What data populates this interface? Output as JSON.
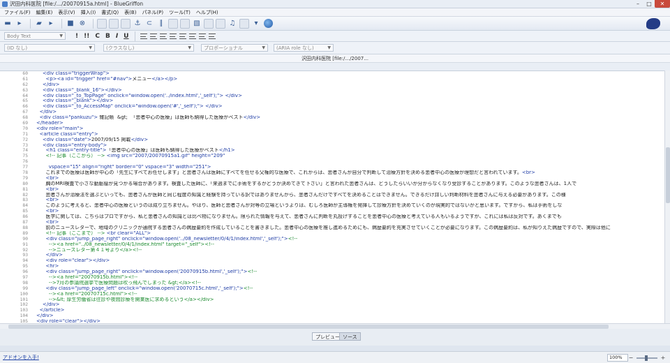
{
  "window": {
    "title": "沢田内科医院 [file:/.../20070915a.html] - BlueGriffon",
    "controls": [
      "–",
      "□",
      "✕"
    ]
  },
  "menu": [
    "ファイル(F)",
    "編集(E)",
    "表示(V)",
    "挿入(I)",
    "書式(Q)",
    "表(B)",
    "パネル(P)",
    "ツール(T)",
    "ヘルプ(H)"
  ],
  "format_toolbar": {
    "paragraph_style": "Body Text",
    "buttons": [
      "!",
      "!!",
      "C",
      "B",
      "I",
      "U"
    ]
  },
  "style_toolbar": {
    "id_select": "(ID なし)",
    "class_select": "(クラスなし)",
    "role_select": "プロポーショナル",
    "aria_select": "(ARIA role なし)"
  },
  "doc_tab_title": "沢田内科医院 [file:/.../2007...",
  "source_lines": [
    {
      "n": "60",
      "segs": [
        [
          "tag",
          "    <div class=\"triggerWrap\">"
        ]
      ]
    },
    {
      "n": "61",
      "segs": [
        [
          "tag",
          "      <p><a id=\"trigger\" href=\"#nav\">"
        ],
        [
          "txt",
          "メニュー"
        ],
        [
          "tag",
          "</a></p>"
        ]
      ]
    },
    {
      "n": "62",
      "segs": [
        [
          "tag",
          "    </div>"
        ]
      ]
    },
    {
      "n": "63",
      "segs": [
        [
          "tag",
          "    <div class=\"_blank_16\"></div>"
        ]
      ]
    },
    {
      "n": "64",
      "segs": [
        [
          "tag",
          "    <div class=\"_to_TopPage\" onclick=\"window.open('../index.html','_self');\"> </div>"
        ]
      ]
    },
    {
      "n": "65",
      "segs": [
        [
          "tag",
          "    <div class=\"_blank\"></div>"
        ]
      ]
    },
    {
      "n": "66",
      "segs": [
        [
          "tag",
          "    <div class=\"_to_AccessMap\" onclick=\"window.open('#','_self');\"> </div>"
        ]
      ]
    },
    {
      "n": "67",
      "segs": [
        [
          "tag",
          "  </div>"
        ]
      ]
    },
    {
      "n": "68",
      "segs": [
        [
          "tag",
          "  <div class=\"pankuzu\">"
        ],
        [
          "txt",
          " 雑記帳  &gt;  「患者中心の医療」は医師も納得した医療がベスト"
        ],
        [
          "tag",
          "</div>"
        ]
      ]
    },
    {
      "n": "69",
      "segs": [
        [
          "tag",
          "</header>"
        ]
      ]
    },
    {
      "n": "70",
      "segs": [
        [
          "tag",
          "<div role=\"main\">"
        ]
      ]
    },
    {
      "n": "71",
      "segs": [
        [
          "tag",
          "  <article class=\"entry\">"
        ]
      ]
    },
    {
      "n": "72",
      "segs": [
        [
          "tag",
          "    <div class=\"date\">"
        ],
        [
          "txt",
          "2007/09/15 掲載"
        ],
        [
          "tag",
          "</div>"
        ]
      ]
    },
    {
      "n": "73",
      "segs": [
        [
          "tag",
          "    <div class=\"entry-body\">"
        ]
      ]
    },
    {
      "n": "74",
      "segs": [
        [
          "tag",
          "      <h1 class=\"entry-title\">"
        ],
        [
          "txt",
          "「患者中心の医療」は医師も納得した医療がベスト"
        ],
        [
          "tag",
          "</h1>"
        ]
      ]
    },
    {
      "n": "75",
      "segs": [
        [
          "comment",
          "      <!-- 記事（ここから） -->"
        ],
        [
          "tag",
          " <img src=\"2007/20070915a1.gif\" height=\"209\""
        ]
      ]
    },
    {
      "n": "76",
      "segs": [
        [
          "txt",
          ""
        ]
      ]
    },
    {
      "n": "77",
      "segs": [
        [
          "tag",
          "        vspace=\"15\" align=\"right\" border=\"0\" vspace=\"3\" width=\"251\">"
        ]
      ]
    },
    {
      "n": "78",
      "segs": [
        [
          "txt",
          "      これまでの医療は医師が中心の「先生にすべてお任せします」と患者さんは医師にすべてを任せる父権的な医療で、これからは、患者さんが自分で判断して治療方針を決める患者中心の医療が理想だと言われています。"
        ],
        [
          "tag",
          "<br>"
        ]
      ]
    },
    {
      "n": "79",
      "segs": [
        [
          "tag",
          "      <br>"
        ]
      ]
    },
    {
      "n": "80",
      "segs": [
        [
          "txt",
          "      胸のMRI検査で小さな動脈瘤が見つかる場合があります。検査した医師に、「来週までに手術をするかどうか決めてきて下さい」と言われた患者さんは、どうしたらいいか分からなくなり受診することがあります。このような患者さんは、1人で"
        ]
      ]
    },
    {
      "n": "81",
      "segs": [
        [
          "tag",
          "      <br>"
        ]
      ]
    },
    {
      "n": "82",
      "segs": [
        [
          "txt",
          "      患者さんが治療法を選ぶといっても、患者さんが医師と同じ程度の知識と経験を持っている訳ではありませんから、患者さんだけですべてを決めることはできません。できるだけ詳しい判断材料を患者さんに与える必要があります。この様"
        ]
      ]
    },
    {
      "n": "83",
      "segs": [
        [
          "tag",
          "      <br>"
        ]
      ]
    },
    {
      "n": "84",
      "segs": [
        [
          "txt",
          "      このように考えると、患者中心の医療というのは成り立ちません。やはり、医師と患者さんが対等の立場というよりは、むしろ医師が主導権を発揮して診療方針を決めていくのが現実的ではないかと思います。ですから、私は手術をしな"
        ]
      ]
    },
    {
      "n": "85",
      "segs": [
        [
          "tag",
          "      <br>"
        ]
      ]
    },
    {
      "n": "86",
      "segs": [
        [
          "txt",
          "      医学に関しては、こちらはプロですから、私と患者さんの知識とは比べ物になりません。限られた情報を与えて、患者さんに判断を丸投げすることを患者中心の医療と考えている人もいるようですが、これには私は反対です。あくまでも"
        ]
      ]
    },
    {
      "n": "87",
      "segs": [
        [
          "tag",
          "      <br>"
        ]
      ]
    },
    {
      "n": "88",
      "segs": [
        [
          "txt",
          "      前のニュースレターで、地域のクリニックが通院する患者さんの病歴要約を作成していることを書きました。患者中心の医療を推し進めるためにも、病歴要約を充実させていくことが必要になります。この病歴要約は、私が知りえた病歴ですので、実際は他に"
        ]
      ]
    },
    {
      "n": "89",
      "segs": [
        [
          "comment",
          "      <!-- 記事（ここまで） -->"
        ],
        [
          "tag",
          " <br clear=\"ALL\">"
        ]
      ]
    },
    {
      "n": "90",
      "segs": [
        [
          "tag",
          "      <div class=\"jump_page_right\" onclick=\"window.open('../08_newsletter/0/4/1/index.html','_self');\">"
        ],
        [
          "comment",
          "<!--"
        ]
      ]
    },
    {
      "n": "91",
      "segs": [
        [
          "comment",
          "        --><a href=\"../08_newsletter/0/4/1/index.html\" target=\"_self\"><!--"
        ]
      ]
    },
    {
      "n": "92",
      "segs": [
        [
          "comment",
          "        -->ニュースレター第４１号より</a><!--"
        ]
      ]
    },
    {
      "n": "93",
      "segs": [
        [
          "tag",
          "      </div>"
        ]
      ]
    },
    {
      "n": "94",
      "segs": [
        [
          "tag",
          "      <div role=\"clear\"></div>"
        ]
      ]
    },
    {
      "n": "95",
      "segs": [
        [
          "tag",
          "      <hr>"
        ]
      ]
    },
    {
      "n": "96",
      "segs": [
        [
          "tag",
          "      <div class=\"jump_page_right\" onclick=\"window.open('20070915b.html','_self');\">"
        ],
        [
          "comment",
          "<!--"
        ]
      ]
    },
    {
      "n": "97",
      "segs": [
        [
          "comment",
          "        --><a href=\"20070915b.html\"><!--"
        ]
      ]
    },
    {
      "n": "98",
      "segs": [
        [
          "comment",
          "        -->7月の参議院選挙で医療問題は吹っ飛んでしまった &gt;</a><!--"
        ]
      ]
    },
    {
      "n": "99",
      "segs": [
        [
          "tag",
          "      <div class=\"jump_page_left\" onclick=\"window.open('20070715c.html','_self');\">"
        ],
        [
          "comment",
          "<!--"
        ]
      ]
    },
    {
      "n": "100",
      "segs": [
        [
          "comment",
          "        --><a href=\"20070715c.html\"><!--"
        ]
      ]
    },
    {
      "n": "101",
      "segs": [
        [
          "comment",
          "        -->&lt; 厚生労働省は往診や夜間診療を開業医に求めるという</a></div>"
        ]
      ]
    },
    {
      "n": "102",
      "segs": [
        [
          "tag",
          "    </div>"
        ]
      ]
    },
    {
      "n": "103",
      "segs": [
        [
          "tag",
          "  </article>"
        ]
      ]
    },
    {
      "n": "104",
      "segs": [
        [
          "tag",
          "</div>"
        ]
      ]
    },
    {
      "n": "105",
      "segs": [
        [
          "tag",
          "<div role=\"clear\"></div>"
        ]
      ]
    },
    {
      "n": "106",
      "segs": [
        [
          "tag",
          "<div role=\"clear\"></div>"
        ]
      ]
    }
  ],
  "view_tabs": {
    "preview": "プレビュー",
    "source": "ソース"
  },
  "status": {
    "addons_link": "アドオンを入手!",
    "zoom": "100%"
  }
}
